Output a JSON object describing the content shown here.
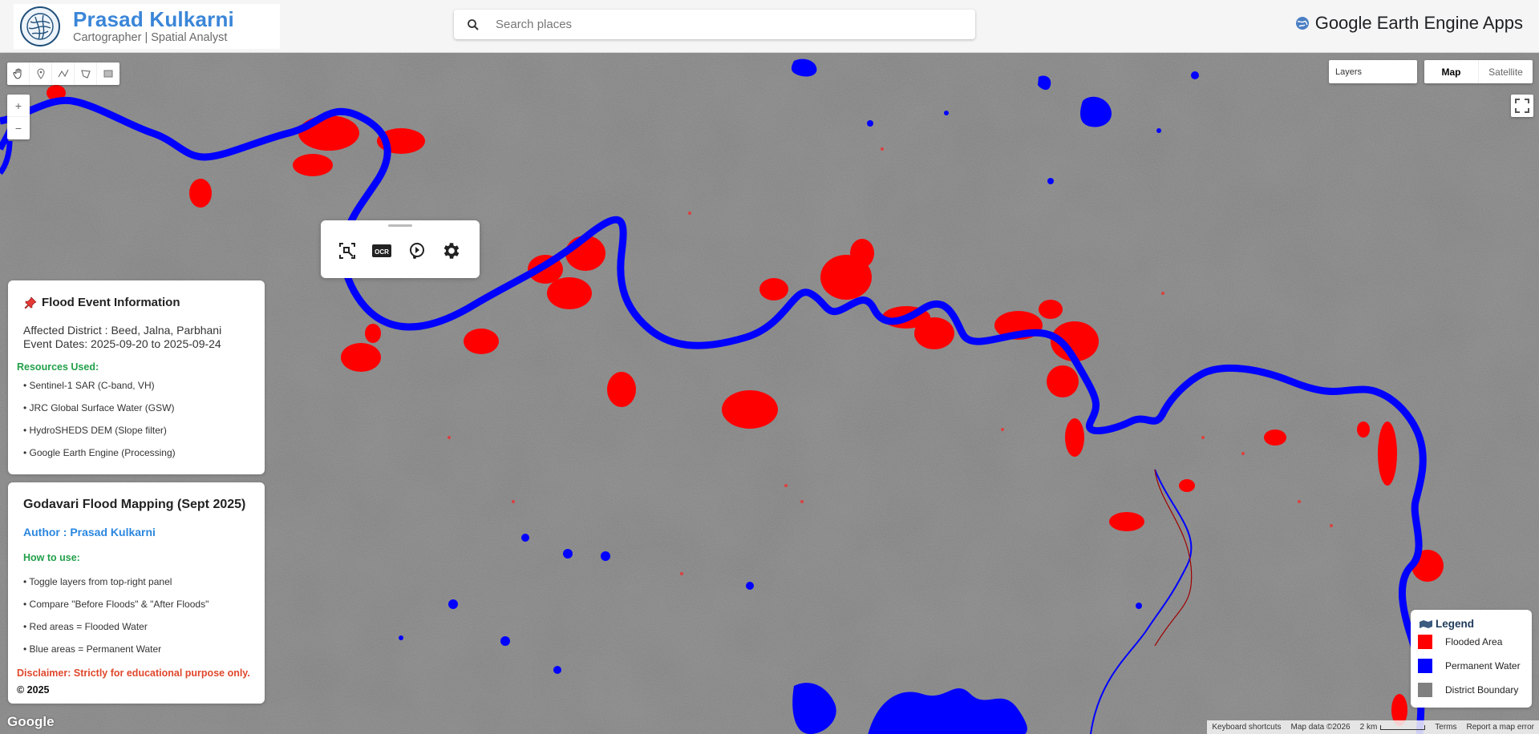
{
  "header": {
    "brand_name": "Prasad Kulkarni",
    "brand_subtitle": "Cartographer | Spatial Analyst",
    "search_placeholder": "Search places",
    "app_title": "Google Earth Engine Apps"
  },
  "map_controls": {
    "draw_tools": [
      "hand-icon",
      "point-marker-icon",
      "line-draw-icon",
      "polygon-draw-icon",
      "rectangle-draw-icon"
    ],
    "zoom_in": "+",
    "zoom_out": "−",
    "layers_label": "Layers",
    "map_type": {
      "map": "Map",
      "satellite": "Satellite",
      "selected": "Map"
    }
  },
  "floating_toolbar": {
    "buttons": [
      "screen-select-icon",
      "ocr-icon",
      "play-circle-icon",
      "settings-gear-icon"
    ],
    "ocr_label": "OCR"
  },
  "info_panel": {
    "title": "Flood Event Information",
    "district": "Affected District : Beed, Jalna, Parbhani",
    "dates": "Event Dates: 2025-09-20 to 2025-09-24",
    "resources_title": "Resources Used:",
    "resources": [
      "• Sentinel-1 SAR (C-band, VH)",
      "• JRC Global Surface Water (GSW)",
      "• HydroSHEDS DEM (Slope filter)",
      "• Google Earth Engine (Processing)"
    ]
  },
  "about_panel": {
    "title": "Godavari Flood Mapping (Sept 2025)",
    "author": "Author : Prasad Kulkarni",
    "how_title": "How to use:",
    "steps": [
      "• Toggle layers from top-right panel",
      "• Compare \"Before Floods\" & \"After Floods\"",
      "• Red areas = Flooded Water",
      "• Blue areas = Permanent Water"
    ],
    "disclaimer": "Disclaimer: Strictly for educational purpose only.",
    "copyright": "© 2025"
  },
  "legend": {
    "title": "Legend",
    "items": [
      {
        "label": "Flooded Area",
        "color": "#ff0000"
      },
      {
        "label": "Permanent Water",
        "color": "#0000ff"
      },
      {
        "label": "District Boundary",
        "color": "#808080"
      }
    ]
  },
  "footer": {
    "google": "Google",
    "keyboard_shortcuts": "Keyboard shortcuts",
    "map_data": "Map data ©2026",
    "scale": "2 km",
    "terms": "Terms",
    "report": "Report a map error"
  },
  "colors": {
    "flood": "#ff0000",
    "permanent_water": "#0000ff",
    "brand": "#3a86d8",
    "resources_green": "#22a04a",
    "disclaimer_red": "#e0472c"
  }
}
